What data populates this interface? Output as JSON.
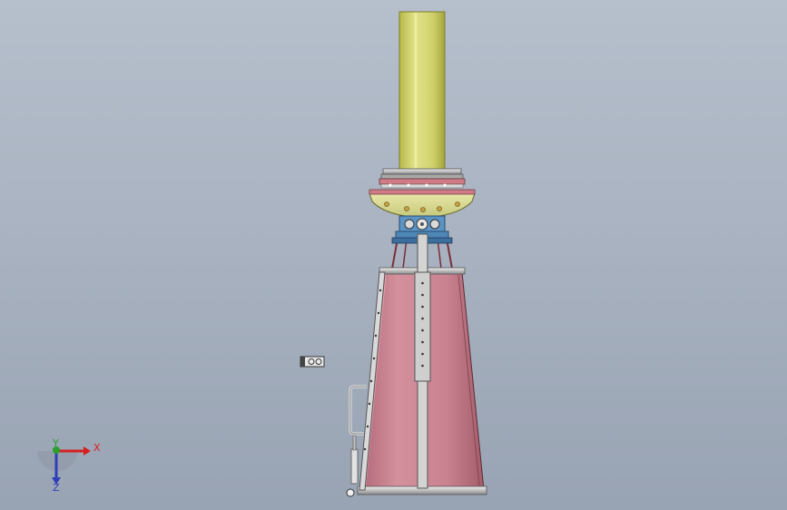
{
  "viewport": {
    "background_top": "#b6bfcc",
    "background_bottom": "#98a3b3"
  },
  "model": {
    "colors": {
      "cylinder": "#d7d878",
      "cylinder_dark": "#a8aa3c",
      "cone": "#c98290",
      "cone_dark": "#9f5c6a",
      "frame": "#d9d9d9",
      "frame_dark": "#777777",
      "joint": "#4f87b8",
      "flange": "#cf7c86"
    },
    "bracket_icon": "bracket-icon"
  },
  "triad": {
    "x_label": "X",
    "y_label": "Y",
    "z_label": "Z",
    "x_color": "#d62020",
    "y_color": "#2aa02a",
    "z_color": "#2c3fb8"
  }
}
